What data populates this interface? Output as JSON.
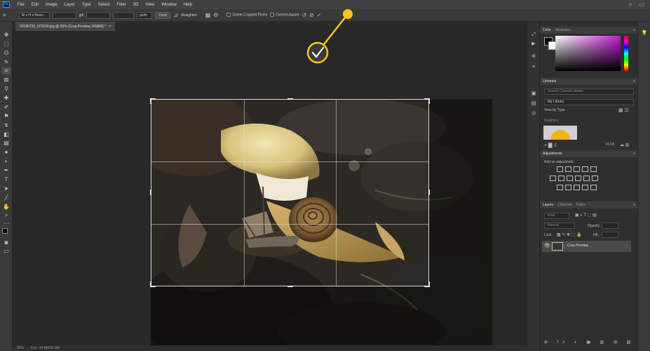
{
  "app": {
    "logo_text": "Ps"
  },
  "menu": [
    "File",
    "Edit",
    "Image",
    "Layer",
    "Type",
    "Select",
    "Filter",
    "3D",
    "View",
    "Window",
    "Help"
  ],
  "options_bar": {
    "ratio_select": "W x H x Reso...",
    "unit_select": "px/in",
    "clear_label": "Clear",
    "straighten_label": "Straighten",
    "delete_cropped_label": "Delete Cropped Pixels",
    "content_aware_label": "Content-Aware"
  },
  "document": {
    "tab_title": "20190725_073150.jpg @ 25% (Crop Preview, RGB/8) *",
    "tab_close": "×"
  },
  "status_bar": {
    "zoom": "25%",
    "doc_info": "Doc: 34.9M/34.9M"
  },
  "panels": {
    "color": {
      "tabs": [
        "Color",
        "Swatches"
      ]
    },
    "libraries": {
      "title": "Libraries",
      "search_placeholder": "Search Current Library",
      "library_name": "My Library",
      "view_by": "View by Type",
      "section_label": "Graphics",
      "item_size": "24 KB"
    },
    "adjustments": {
      "title": "Adjustments",
      "subtitle": "Add an adjustment"
    },
    "layers": {
      "tabs": [
        "Layers",
        "Channels",
        "Paths"
      ],
      "kind_placeholder": "Kind",
      "blend_mode": "Normal",
      "opacity_label": "Opacity:",
      "lock_label": "Lock:",
      "fill_label": "Fill:",
      "layer_name": "Crop Preview"
    }
  },
  "colors": {
    "accent": "#fcc419",
    "fg_swatch": "#000000",
    "bg_swatch": "#ffffff"
  }
}
